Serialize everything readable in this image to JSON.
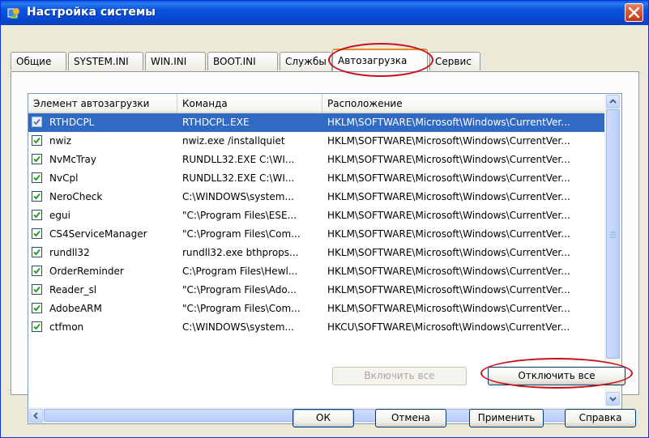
{
  "window": {
    "title": "Настройка системы"
  },
  "tabs": [
    {
      "label": "Общие"
    },
    {
      "label": "SYSTEM.INI"
    },
    {
      "label": "WIN.INI"
    },
    {
      "label": "BOOT.INI"
    },
    {
      "label": "Службы"
    },
    {
      "label": "Автозагрузка",
      "active": true
    },
    {
      "label": "Сервис"
    }
  ],
  "list": {
    "columns": [
      "Элемент автозагрузки",
      "Команда",
      "Расположение"
    ],
    "rows": [
      {
        "name": "RTHDCPL",
        "command": "RTHDCPL.EXE",
        "location": "HKLM\\SOFTWARE\\Microsoft\\Windows\\CurrentVer...",
        "checked": true,
        "selected": true
      },
      {
        "name": "nwiz",
        "command": "nwiz.exe /installquiet",
        "location": "HKLM\\SOFTWARE\\Microsoft\\Windows\\CurrentVer...",
        "checked": true
      },
      {
        "name": "NvMcTray",
        "command": "RUNDLL32.EXE C:\\WI...",
        "location": "HKLM\\SOFTWARE\\Microsoft\\Windows\\CurrentVer...",
        "checked": true
      },
      {
        "name": "NvCpl",
        "command": "RUNDLL32.EXE C:\\WI...",
        "location": "HKLM\\SOFTWARE\\Microsoft\\Windows\\CurrentVer...",
        "checked": true
      },
      {
        "name": "NeroCheck",
        "command": "C:\\WINDOWS\\system...",
        "location": "HKLM\\SOFTWARE\\Microsoft\\Windows\\CurrentVer...",
        "checked": true
      },
      {
        "name": "egui",
        "command": "\"C:\\Program Files\\ESE...",
        "location": "HKLM\\SOFTWARE\\Microsoft\\Windows\\CurrentVer...",
        "checked": true
      },
      {
        "name": "CS4ServiceManager",
        "command": "\"C:\\Program Files\\Com...",
        "location": "HKLM\\SOFTWARE\\Microsoft\\Windows\\CurrentVer...",
        "checked": true
      },
      {
        "name": "rundll32",
        "command": "rundll32.exe bthprops...",
        "location": "HKLM\\SOFTWARE\\Microsoft\\Windows\\CurrentVer...",
        "checked": true
      },
      {
        "name": "OrderReminder",
        "command": "C:\\Program Files\\Hewl...",
        "location": "HKLM\\SOFTWARE\\Microsoft\\Windows\\CurrentVer...",
        "checked": true
      },
      {
        "name": "Reader_sl",
        "command": "\"C:\\Program Files\\Ado...",
        "location": "HKLM\\SOFTWARE\\Microsoft\\Windows\\CurrentVer...",
        "checked": true
      },
      {
        "name": "AdobeARM",
        "command": "\"C:\\Program Files\\Com...",
        "location": "HKLM\\SOFTWARE\\Microsoft\\Windows\\CurrentVer...",
        "checked": true
      },
      {
        "name": "ctfmon",
        "command": "C:\\WINDOWS\\system...",
        "location": "HKCU\\SOFTWARE\\Microsoft\\Windows\\CurrentVer...",
        "checked": true
      }
    ]
  },
  "actions": {
    "enable_all": "Включить все",
    "disable_all": "Отключить все"
  },
  "footer": {
    "ok": "ОК",
    "cancel": "Отмена",
    "apply": "Применить",
    "help": "Справка"
  },
  "colors": {
    "titlebar": "#0a49d2",
    "selection": "#316ac5",
    "highlight_ring": "#c8101a",
    "active_tab_accent": "#e68b2c"
  }
}
